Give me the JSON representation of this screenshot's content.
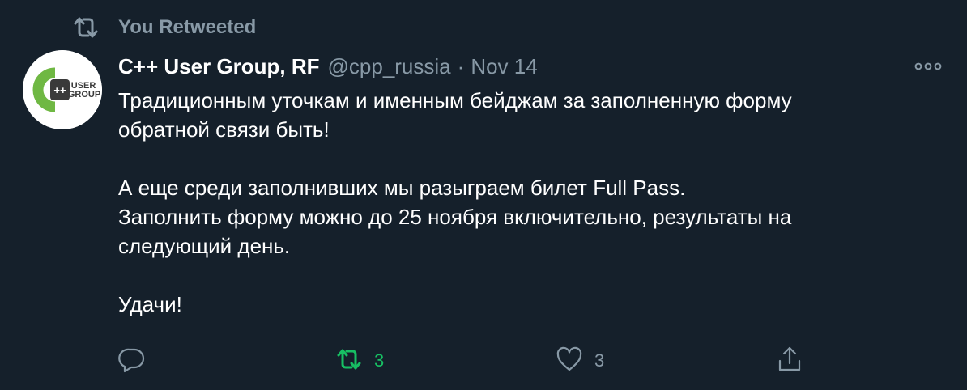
{
  "social_context": {
    "label": "You Retweeted"
  },
  "author": {
    "name": "C++ User Group, RF",
    "handle": "@cpp_russia",
    "separator": "·",
    "date": "Nov 14",
    "avatar_logo_lines": [
      "USER",
      "GROUP"
    ],
    "avatar_logo_plus": "++"
  },
  "tweet": {
    "paragraphs": [
      "Традиционным уточкам и именным бейджам за заполненную форму\nобратной связи быть!",
      "А еще среди заполнивших мы разыграем билет Full Pass.\nЗаполнить форму можно до 25 ноября включительно, результаты на\nследующий день.",
      "Удачи!"
    ]
  },
  "actions": {
    "reply": {
      "icon": "reply-icon",
      "count": ""
    },
    "retweet": {
      "icon": "retweet-icon",
      "count": "3",
      "active": true,
      "active_color": "#17bf63"
    },
    "like": {
      "icon": "heart-icon",
      "count": "3"
    },
    "share": {
      "icon": "share-icon",
      "count": ""
    }
  },
  "colors": {
    "background": "#15202b",
    "text_primary": "#ffffff",
    "text_secondary": "#8899a6",
    "retweet_active": "#17bf63",
    "logo_green": "#6fb843",
    "logo_dark": "#3a3a3a"
  }
}
